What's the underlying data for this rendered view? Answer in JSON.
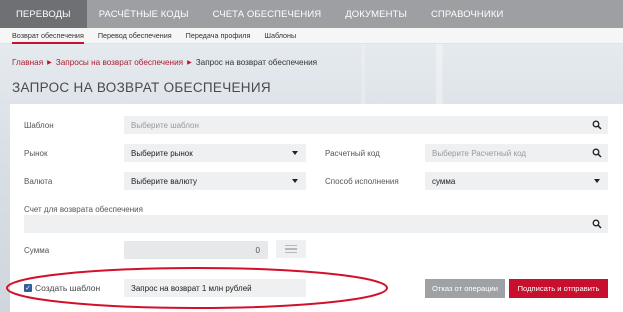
{
  "nav": {
    "items": [
      "ПЕРЕВОДЫ",
      "РАСЧЁТНЫЕ КОДЫ",
      "СЧЕТА ОБЕСПЕЧЕНИЯ",
      "ДОКУМЕНТЫ",
      "СПРАВОЧНИКИ"
    ]
  },
  "subnav": {
    "items": [
      "Возврат обеспечения",
      "Перевод обеспечения",
      "Передача профиля",
      "Шаблоны"
    ]
  },
  "breadcrumb": {
    "home": "Главная",
    "section": "Запросы на возврат обеспечения",
    "current": "Запрос на возврат обеспечения"
  },
  "page_title": "ЗАПРОС НА ВОЗВРАТ ОБЕСПЕЧЕНИЯ",
  "form": {
    "template_label": "Шаблон",
    "template_placeholder": "Выберите шаблон",
    "market_label": "Рынок",
    "market_value": "Выберите рынок",
    "settlement_code_label": "Расчетный код",
    "settlement_code_placeholder": "Выберите Расчетный код",
    "currency_label": "Валюта",
    "currency_value": "Выберите валюту",
    "execution_label": "Способ исполнения",
    "execution_value": "сумма",
    "account_label": "Счет для возврата обеспечения",
    "amount_label": "Сумма",
    "amount_value": "0",
    "create_template_label": "Создать шаблон",
    "create_template_checked": true,
    "template_name_value": "Запрос на возврат 1 млн рублей"
  },
  "buttons": {
    "cancel": "Отказ от операции",
    "submit": "Подписать и отправить"
  },
  "colors": {
    "accent": "#c8102e",
    "nav_bg": "#9d9fa2",
    "nav_active": "#6e7073",
    "highlight_ellipse": "#d3102a"
  }
}
